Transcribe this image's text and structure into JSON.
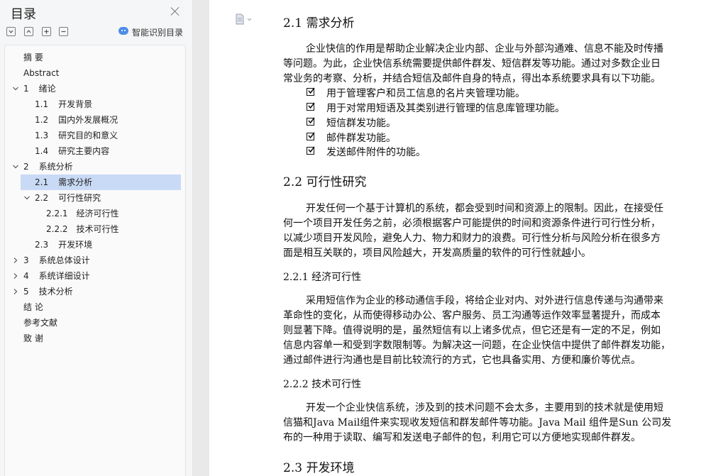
{
  "nav": {
    "title": "目录",
    "smart_toc_label": "智能识别目录",
    "toc": [
      {
        "num": "",
        "label": "摘  要",
        "level": 0,
        "chevron": "none"
      },
      {
        "num": "",
        "label": "Abstract",
        "level": 0,
        "chevron": "none"
      },
      {
        "num": "1",
        "label": "绪论",
        "level": 0,
        "chevron": "expanded"
      },
      {
        "num": "1.1",
        "label": "开发背景",
        "level": 1,
        "chevron": "none"
      },
      {
        "num": "1.2",
        "label": "国内外发展概况",
        "level": 1,
        "chevron": "none"
      },
      {
        "num": "1.3",
        "label": "研究目的和意义",
        "level": 1,
        "chevron": "none"
      },
      {
        "num": "1.4",
        "label": "研究主要内容",
        "level": 1,
        "chevron": "none"
      },
      {
        "num": "2",
        "label": "系统分析",
        "level": 0,
        "chevron": "expanded"
      },
      {
        "num": "2.1",
        "label": "需求分析",
        "level": 1,
        "chevron": "none",
        "selected": true
      },
      {
        "num": "2.2",
        "label": "可行性研究",
        "level": 1,
        "chevron": "expanded"
      },
      {
        "num": "2.2.1",
        "label": "经济可行性",
        "level": 2,
        "chevron": "none"
      },
      {
        "num": "2.2.2",
        "label": "技术可行性",
        "level": 2,
        "chevron": "none"
      },
      {
        "num": "2.3",
        "label": "开发环境",
        "level": 1,
        "chevron": "none"
      },
      {
        "num": "3",
        "label": "系统总体设计",
        "level": 0,
        "chevron": "collapsed"
      },
      {
        "num": "4",
        "label": "系统详细设计",
        "level": 0,
        "chevron": "collapsed"
      },
      {
        "num": "5",
        "label": "技术分析",
        "level": 0,
        "chevron": "collapsed"
      },
      {
        "num": "",
        "label": "结  论",
        "level": 0,
        "chevron": "none"
      },
      {
        "num": "",
        "label": "参考文献",
        "level": 0,
        "chevron": "none"
      },
      {
        "num": "",
        "label": "致    谢",
        "level": 0,
        "chevron": "none"
      }
    ]
  },
  "doc": {
    "s21": {
      "heading": "2.1    需求分析",
      "lines": [
        "企业快信的作用是帮助企业解决企业内部、企业与外部沟通难、信息不能及时传播",
        "等问题。为此，企业快信系统需要提供邮件群发、短信群发等功能。通过对多数企业日",
        "常业务的考察、分析，并结合短信及邮件自身的特点，得出本系统要求具有以下功能。"
      ],
      "bullets": [
        "用于管理客户和员工信息的名片夹管理功能。",
        "用于对常用短语及其类别进行管理的信息库管理功能。",
        "短信群发功能。",
        "邮件群发功能。",
        "发送邮件附件的功能。"
      ]
    },
    "s22": {
      "heading": "2.2    可行性研究",
      "lines": [
        "开发任何一个基于计算机的系统，都会受到时间和资源上的限制。因此，在接受任",
        "何一个项目开发任务之前，必须根据客户可能提供的时间和资源条件进行可行性分析，",
        "以减少项目开发风险，避免人力、物力和财力的浪费。可行性分析与风险分析在很多方",
        "面是相互关联的，项目风险越大，开发高质量的软件的可行性就越小。"
      ]
    },
    "s221": {
      "heading": "2.2.1    经济可行性",
      "lines": [
        "采用短信作为企业的移动通信手段，将给企业对内、对外进行信息传递与沟通带来",
        "革命性的变化，从而使得移动办公、客户服务、员工沟通等运作效率显著提升，而成本",
        "则显著下降。值得说明的是，虽然短信有以上诸多优点，但它还是有一定的不足，例如",
        "信息内容单一和受到字数限制等。为解决这一问题，在企业快信中提供了邮件群发功能，",
        "通过邮件进行沟通也是目前比较流行的方式，它也具备实用、方便和廉价等优点。"
      ]
    },
    "s222": {
      "heading": "2.2.2    技术可行性",
      "lines": [
        "开发一个企业快信系统，涉及到的技术问题不会太多，主要用到的技术就是使用短",
        "信猫和Java Mail组件来实现收发短信和群发邮件等功能。Java Mail 组件是Sun 公司发",
        "布的一种用于读取、编写和发送电子邮件的包，利用它可以方便地实现邮件群发。"
      ]
    },
    "s23": {
      "heading": "2.3    开发环境"
    }
  }
}
